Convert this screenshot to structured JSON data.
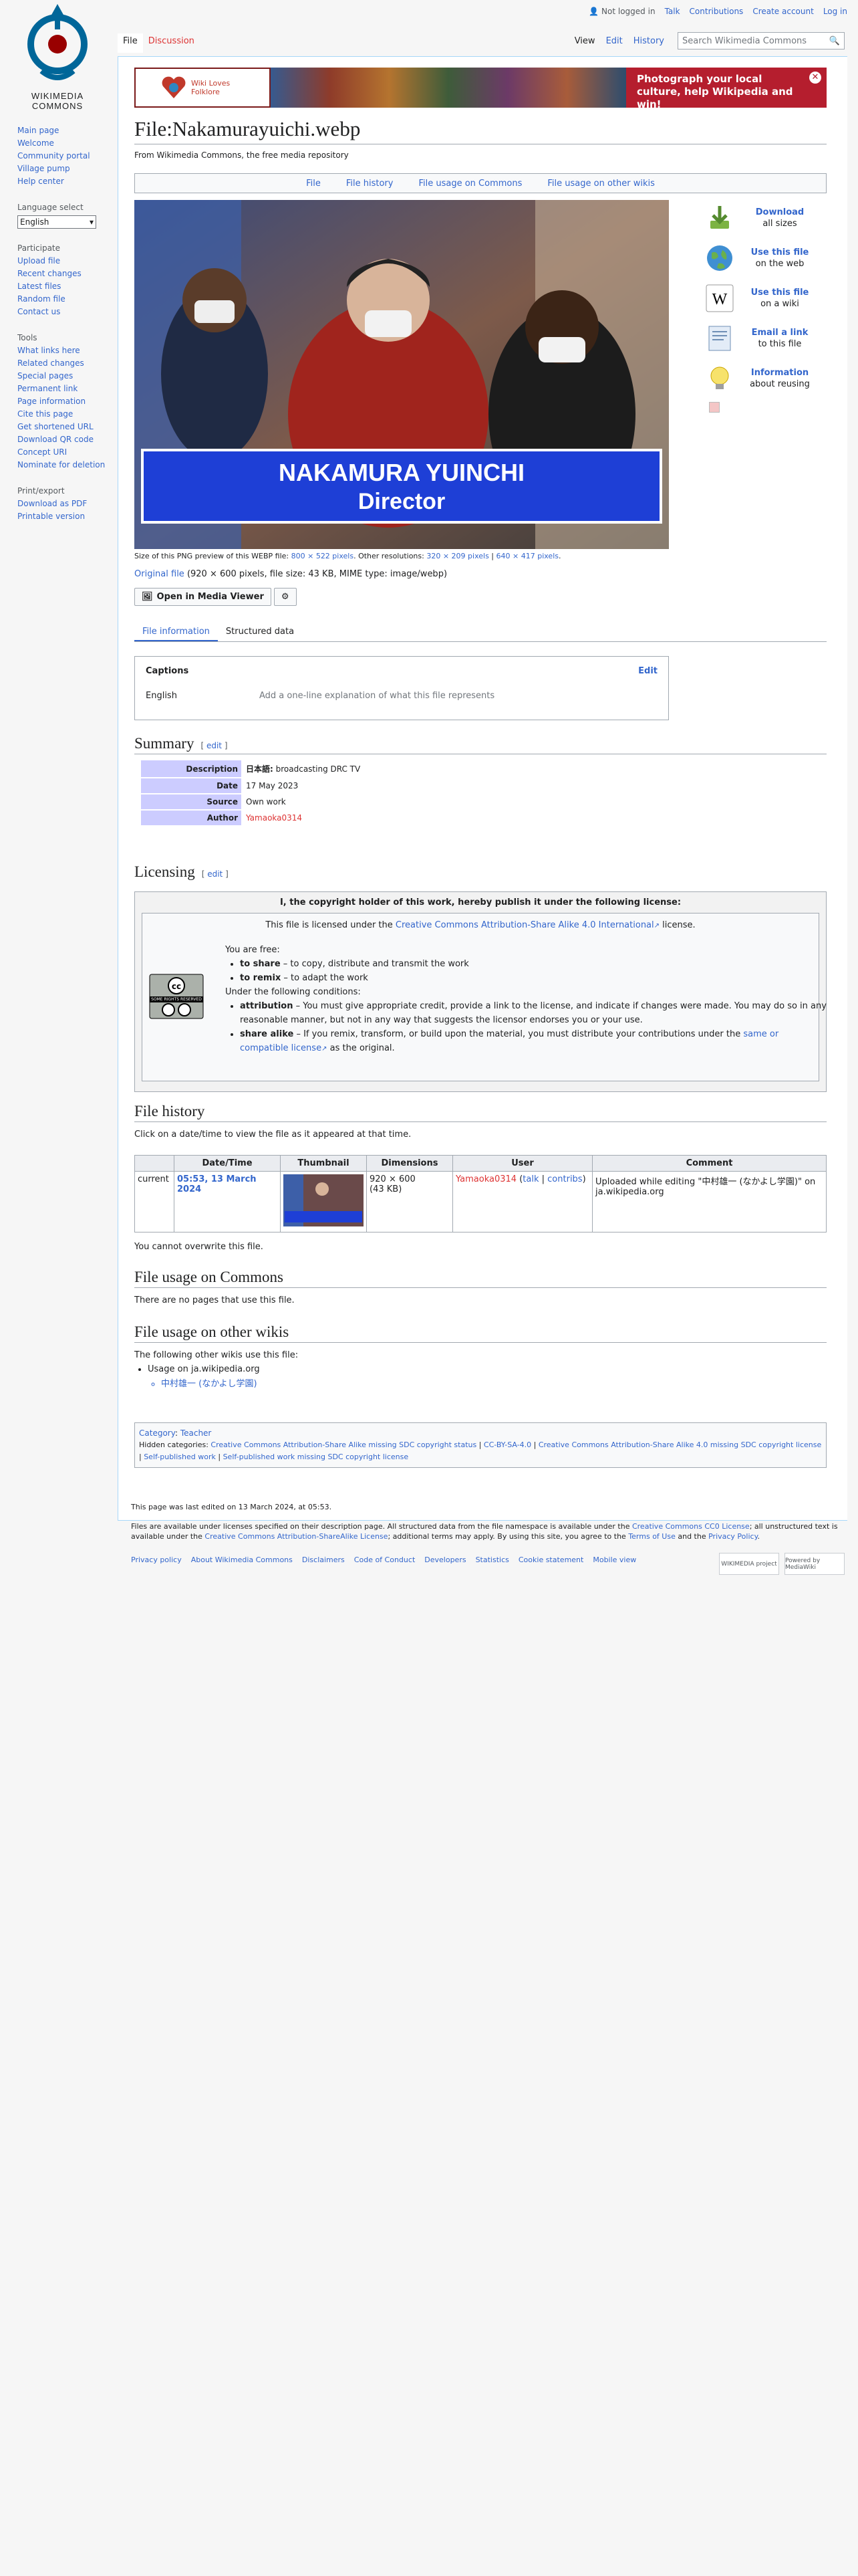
{
  "logo_text": "WIKIMEDIA COMMONS",
  "personal": {
    "not_logged_in": "Not logged in",
    "talk": "Talk",
    "contributions": "Contributions",
    "create_account": "Create account",
    "log_in": "Log in"
  },
  "tabs": {
    "file": "File",
    "discussion": "Discussion",
    "view": "View",
    "edit": "Edit",
    "history": "History"
  },
  "search": {
    "placeholder": "Search Wikimedia Commons"
  },
  "sidebar": {
    "nav": [
      "Main page",
      "Welcome",
      "Community portal",
      "Village pump",
      "Help center"
    ],
    "language_heading": "Language select",
    "language_value": "English",
    "participate_heading": "Participate",
    "participate": [
      "Upload file",
      "Recent changes",
      "Latest files",
      "Random file",
      "Contact us"
    ],
    "tools_heading": "Tools",
    "tools": [
      "What links here",
      "Related changes",
      "Special pages",
      "Permanent link",
      "Page information",
      "Cite this page",
      "Get shortened URL",
      "Download QR code",
      "Concept URI",
      "Nominate for deletion"
    ],
    "print_heading": "Print/export",
    "print": [
      "Download as PDF",
      "Printable version"
    ]
  },
  "banner": {
    "logo_text": "Wiki Loves Folklore",
    "text": "Photograph your local culture, help Wikipedia and win!"
  },
  "page": {
    "title": "File:Nakamurayuichi.webp",
    "site_sub": "From Wikimedia Commons, the free media repository"
  },
  "filetoc": [
    "File",
    "File history",
    "File usage on Commons",
    "File usage on other wikis"
  ],
  "image": {
    "name_text": "NAKAMURA YUINCHI",
    "role_text": "Director"
  },
  "actions": [
    {
      "title": "Download",
      "sub": "all sizes",
      "icon": "download-icon"
    },
    {
      "title": "Use this file",
      "sub": "on the web",
      "icon": "globe-icon"
    },
    {
      "title": "Use this file",
      "sub": "on a wiki",
      "icon": "wikipedia-icon"
    },
    {
      "title": "Email a link",
      "sub": "to this file",
      "icon": "email-icon"
    },
    {
      "title": "Information",
      "sub": "about reusing",
      "icon": "lightbulb-icon"
    }
  ],
  "preview_info": {
    "prefix": "Size of this PNG preview of this WEBP file: ",
    "size_link": "800 × 522 pixels",
    "mid": ". Other resolutions: ",
    "res1": "320 × 209 pixels",
    "sep": " | ",
    "res2": "640 × 417 pixels",
    "end": "."
  },
  "original": {
    "link": "Original file",
    "details": " (920 × 600 pixels, file size: 43 KB, MIME type: image/webp)"
  },
  "mmv_button": "Open in Media Viewer",
  "subtabs": {
    "info": "File information",
    "structured": "Structured data"
  },
  "captions": {
    "heading": "Captions",
    "edit": "Edit",
    "lang": "English",
    "placeholder": "Add a one-line explanation of what this file represents"
  },
  "summary": {
    "heading": "Summary",
    "edit": "edit",
    "rows": [
      {
        "k": "Description",
        "v_lang": "日本語:",
        "v": " broadcasting DRC TV"
      },
      {
        "k": "Date",
        "v": "17 May 2023"
      },
      {
        "k": "Source",
        "v": "Own work"
      },
      {
        "k": "Author",
        "v": "Yamaoka0314"
      }
    ]
  },
  "licensing": {
    "heading": "Licensing",
    "edit": "edit",
    "header": "I, the copyright holder of this work, hereby publish it under the following license:",
    "licensed_pre": "This file is licensed under the ",
    "licensed_link": "Creative Commons Attribution-Share Alike 4.0 International",
    "licensed_post": " license.",
    "free": "You are free:",
    "share_b": "to share",
    "share": " – to copy, distribute and transmit the work",
    "remix_b": "to remix",
    "remix": " – to adapt the work",
    "conditions": "Under the following conditions:",
    "attr_b": "attribution",
    "attr": " – You must give appropriate credit, provide a link to the license, and indicate if changes were made. You may do so in any reasonable manner, but not in any way that suggests the licensor endorses you or your use.",
    "sa_b": "share alike",
    "sa": " – If you remix, transform, or build upon the material, you must distribute your contributions under the ",
    "sa_link": "same or compatible license",
    "sa_post": " as the original.",
    "cc_badge": "SOME RIGHTS RESERVED"
  },
  "file_history": {
    "heading": "File history",
    "intro": "Click on a date/time to view the file as it appeared at that time.",
    "headers": [
      "",
      "Date/Time",
      "Thumbnail",
      "Dimensions",
      "User",
      "Comment"
    ],
    "row": {
      "status": "current",
      "datetime": "05:53, 13 March 2024",
      "dims": "920 × 600",
      "size": "(43 KB)",
      "user": "Yamaoka0314",
      "talk": "talk",
      "contribs": "contribs",
      "comment": "Uploaded while editing \"中村雄一 (なかよし学園)\" on ja.wikipedia.org"
    },
    "cannot": "You cannot overwrite this file."
  },
  "usage_commons": {
    "heading": "File usage on Commons",
    "text": "There are no pages that use this file."
  },
  "usage_other": {
    "heading": "File usage on other wikis",
    "text": "The following other wikis use this file:",
    "wiki": "Usage on ja.wikipedia.org",
    "page": "中村雄一 (なかよし学園)"
  },
  "categories": {
    "label": "Category",
    "cat": "Teacher",
    "hidden_label": "Hidden categories",
    "hidden": [
      "Creative Commons Attribution-Share Alike missing SDC copyright status",
      "CC-BY-SA-4.0",
      "Creative Commons Attribution-Share Alike 4.0 missing SDC copyright license",
      "Self-published work",
      "Self-published work missing SDC copyright license"
    ]
  },
  "footer": {
    "edited": "This page was last edited on 13 March 2024, at 05:53.",
    "l1": "Files are available under licenses specified on their description page. All structured data from the file namespace is available under the ",
    "l1_link": "Creative Commons CC0 License",
    "l1_mid": "; all unstructured text is available under the ",
    "l1_link2": "Creative Commons Attribution-ShareAlike License",
    "l1_mid2": "; additional terms may apply. By using this site, you agree to the ",
    "l1_link3": "Terms of Use",
    "l1_and": " and the ",
    "l1_link4": "Privacy Policy",
    "l1_end": ".",
    "links": [
      "Privacy policy",
      "About Wikimedia Commons",
      "Disclaimers",
      "Code of Conduct",
      "Developers",
      "Statistics",
      "Cookie statement",
      "Mobile view"
    ],
    "icon1": "WIKIMEDIA project",
    "icon2": "Powered by MediaWiki"
  }
}
